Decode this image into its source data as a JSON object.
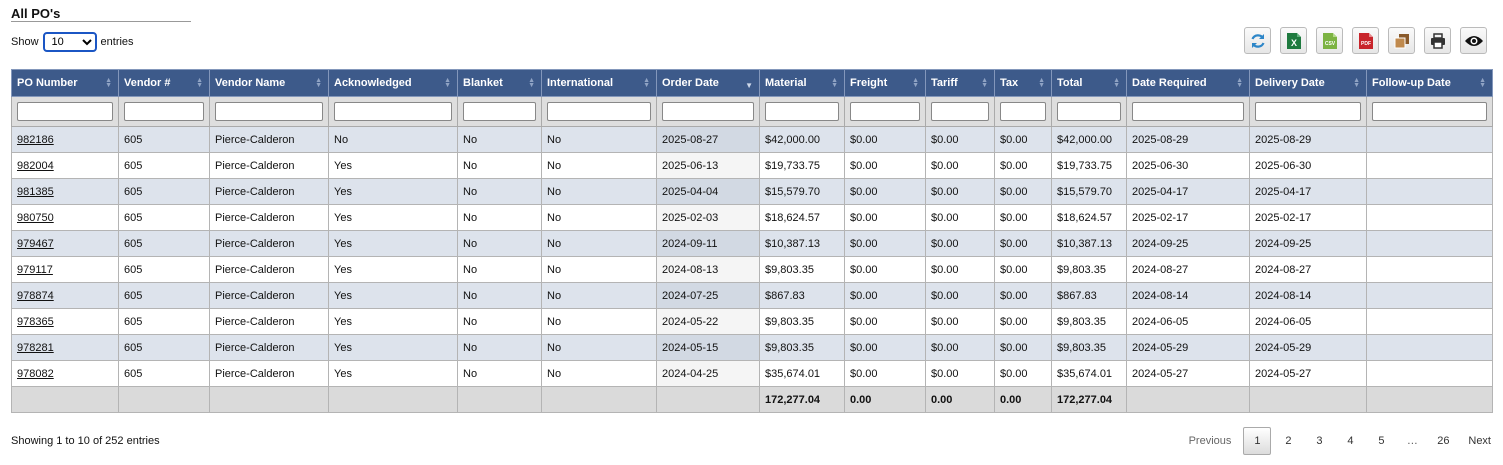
{
  "page": {
    "title": "All PO's"
  },
  "length": {
    "show_label": "Show",
    "selected": "10",
    "entries_label": "entries"
  },
  "toolbar": [
    {
      "name": "refresh-icon",
      "color": "#2d86c8"
    },
    {
      "name": "excel-icon",
      "color": "#1f7a3f",
      "text": "X"
    },
    {
      "name": "csv-icon",
      "color": "#7cb342",
      "text": "CSV"
    },
    {
      "name": "pdf-icon",
      "color": "#c8242b",
      "text": "PDF"
    },
    {
      "name": "copy-icon",
      "color": "#8a5a2b"
    },
    {
      "name": "print-icon",
      "color": "#333333"
    },
    {
      "name": "eye-icon",
      "color": "#111111"
    }
  ],
  "table": {
    "columns": [
      "PO Number",
      "Vendor #",
      "Vendor Name",
      "Acknowledged",
      "Blanket",
      "International",
      "Order Date",
      "Material",
      "Freight",
      "Tariff",
      "Tax",
      "Total",
      "Date Required",
      "Delivery Date",
      "Follow-up Date"
    ],
    "sorted_column": "Order Date",
    "rows": [
      [
        "982186",
        "605",
        "Pierce-Calderon",
        "No",
        "No",
        "No",
        "2025-08-27",
        "$42,000.00",
        "$0.00",
        "$0.00",
        "$0.00",
        "$42,000.00",
        "2025-08-29",
        "2025-08-29",
        ""
      ],
      [
        "982004",
        "605",
        "Pierce-Calderon",
        "Yes",
        "No",
        "No",
        "2025-06-13",
        "$19,733.75",
        "$0.00",
        "$0.00",
        "$0.00",
        "$19,733.75",
        "2025-06-30",
        "2025-06-30",
        ""
      ],
      [
        "981385",
        "605",
        "Pierce-Calderon",
        "Yes",
        "No",
        "No",
        "2025-04-04",
        "$15,579.70",
        "$0.00",
        "$0.00",
        "$0.00",
        "$15,579.70",
        "2025-04-17",
        "2025-04-17",
        ""
      ],
      [
        "980750",
        "605",
        "Pierce-Calderon",
        "Yes",
        "No",
        "No",
        "2025-02-03",
        "$18,624.57",
        "$0.00",
        "$0.00",
        "$0.00",
        "$18,624.57",
        "2025-02-17",
        "2025-02-17",
        ""
      ],
      [
        "979467",
        "605",
        "Pierce-Calderon",
        "Yes",
        "No",
        "No",
        "2024-09-11",
        "$10,387.13",
        "$0.00",
        "$0.00",
        "$0.00",
        "$10,387.13",
        "2024-09-25",
        "2024-09-25",
        ""
      ],
      [
        "979117",
        "605",
        "Pierce-Calderon",
        "Yes",
        "No",
        "No",
        "2024-08-13",
        "$9,803.35",
        "$0.00",
        "$0.00",
        "$0.00",
        "$9,803.35",
        "2024-08-27",
        "2024-08-27",
        ""
      ],
      [
        "978874",
        "605",
        "Pierce-Calderon",
        "Yes",
        "No",
        "No",
        "2024-07-25",
        "$867.83",
        "$0.00",
        "$0.00",
        "$0.00",
        "$867.83",
        "2024-08-14",
        "2024-08-14",
        ""
      ],
      [
        "978365",
        "605",
        "Pierce-Calderon",
        "Yes",
        "No",
        "No",
        "2024-05-22",
        "$9,803.35",
        "$0.00",
        "$0.00",
        "$0.00",
        "$9,803.35",
        "2024-06-05",
        "2024-06-05",
        ""
      ],
      [
        "978281",
        "605",
        "Pierce-Calderon",
        "Yes",
        "No",
        "No",
        "2024-05-15",
        "$9,803.35",
        "$0.00",
        "$0.00",
        "$0.00",
        "$9,803.35",
        "2024-05-29",
        "2024-05-29",
        ""
      ],
      [
        "978082",
        "605",
        "Pierce-Calderon",
        "Yes",
        "No",
        "No",
        "2024-04-25",
        "$35,674.01",
        "$0.00",
        "$0.00",
        "$0.00",
        "$35,674.01",
        "2024-05-27",
        "2024-05-27",
        ""
      ]
    ],
    "footer": [
      "",
      "",
      "",
      "",
      "",
      "",
      "",
      "172,277.04",
      "0.00",
      "0.00",
      "0.00",
      "172,277.04",
      "",
      "",
      ""
    ]
  },
  "info": "Showing 1 to 10 of 252 entries",
  "pagination": {
    "previous": "Previous",
    "pages": [
      "1",
      "2",
      "3",
      "4",
      "5",
      "…",
      "26"
    ],
    "current": "1",
    "next": "Next"
  }
}
